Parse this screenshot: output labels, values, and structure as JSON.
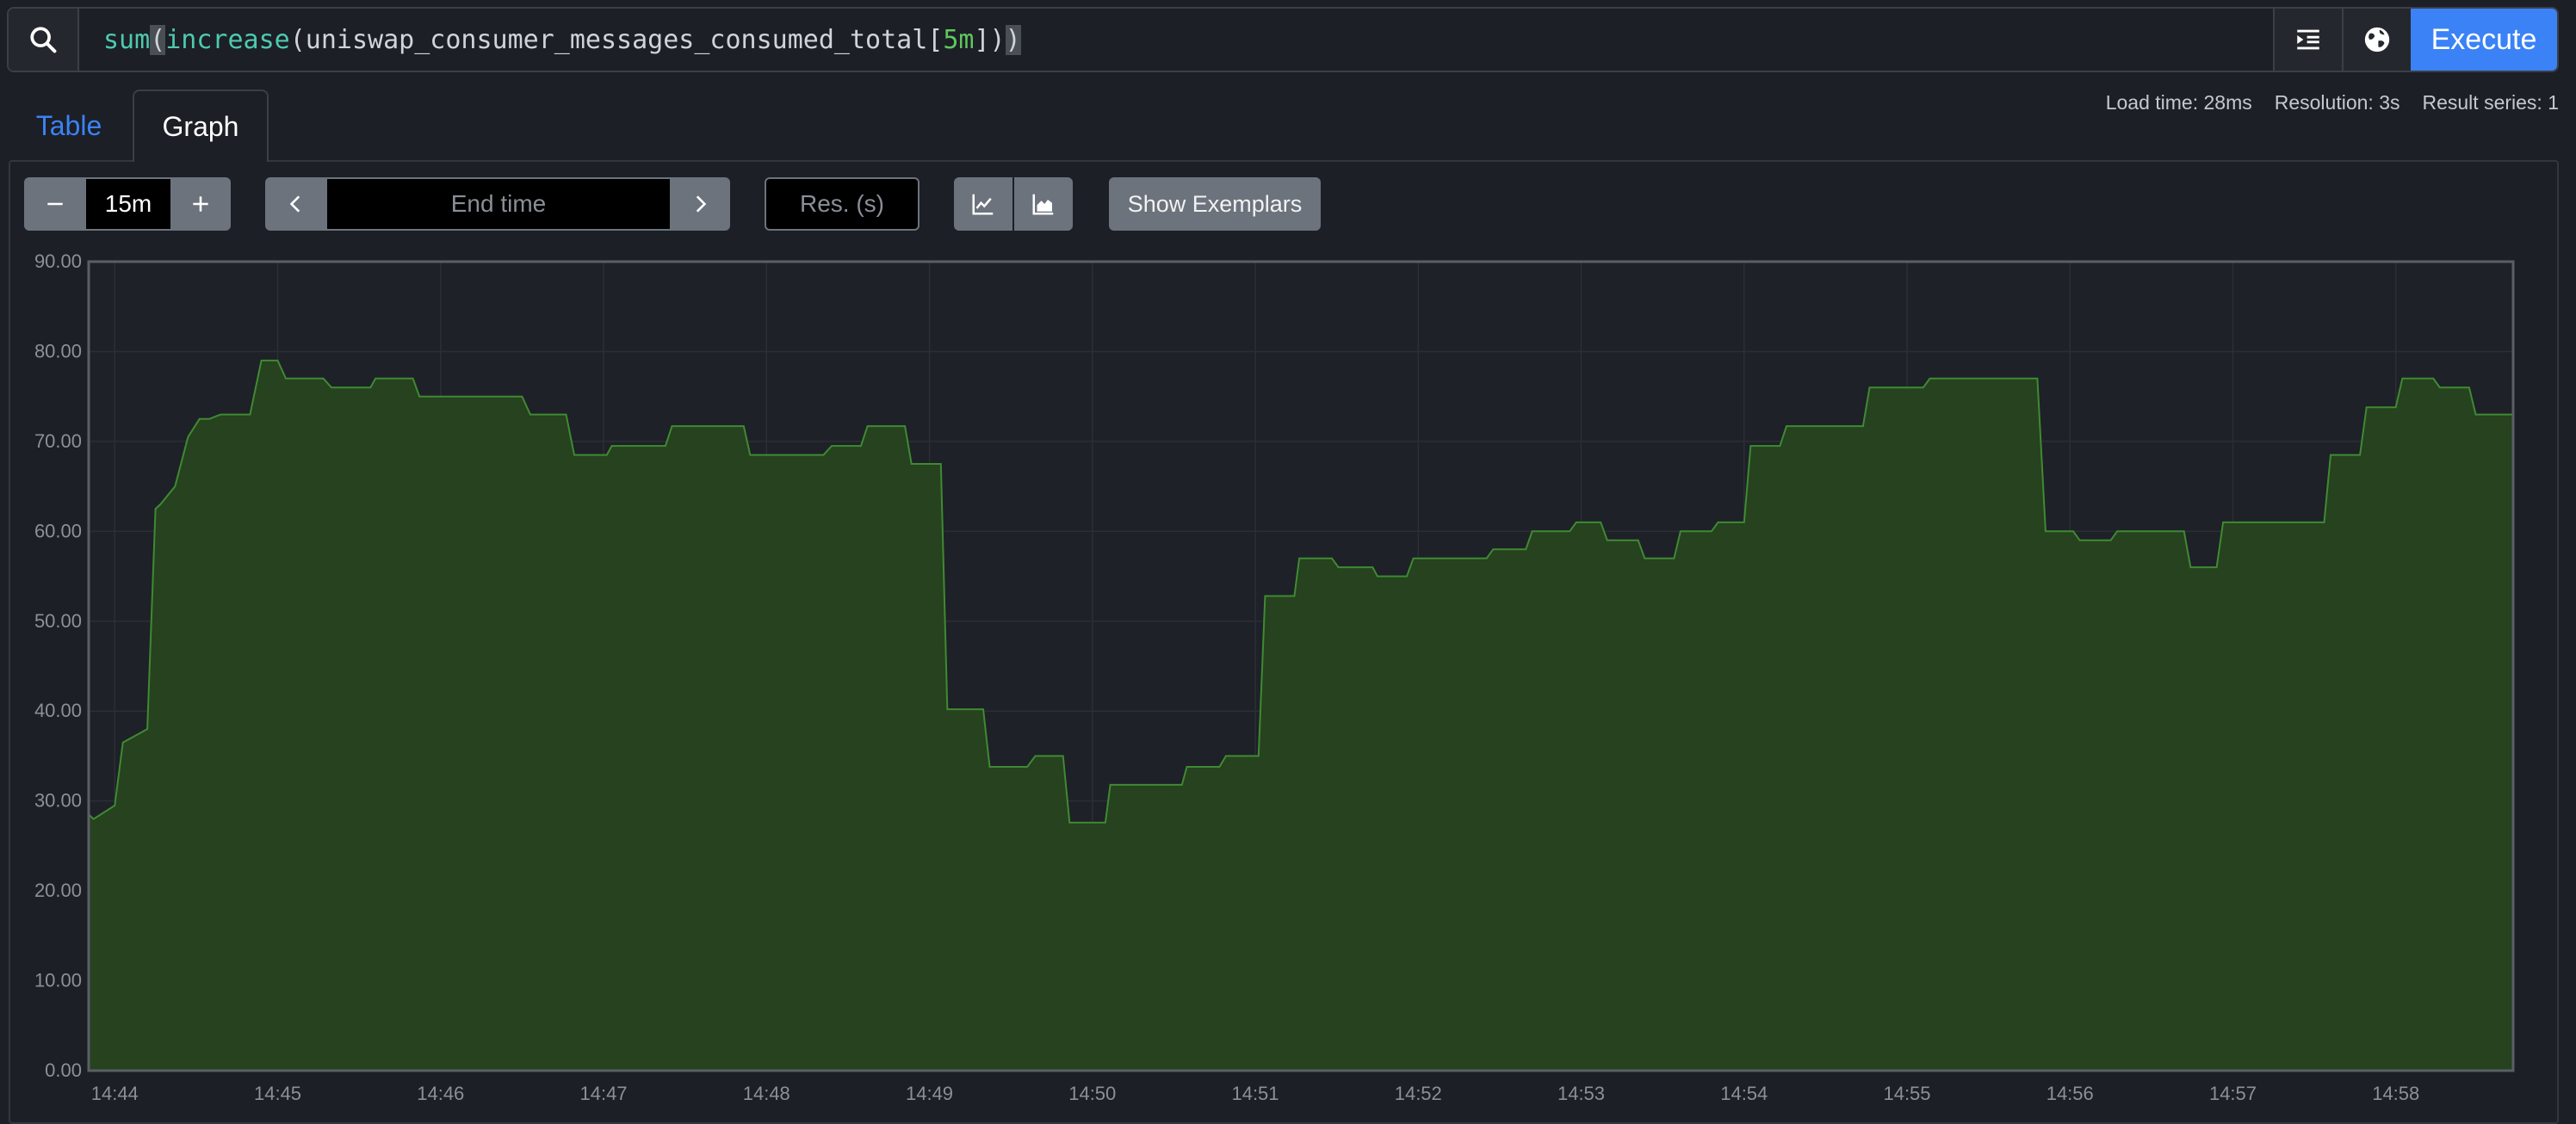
{
  "query_bar": {
    "query_parts": [
      {
        "text": "sum",
        "cls": "fn"
      },
      {
        "text": "(",
        "cls": "hl"
      },
      {
        "text": "increase",
        "cls": "fn"
      },
      {
        "text": "(uniswap_consumer_messages_consumed_total[",
        "cls": "paren"
      },
      {
        "text": "5m",
        "cls": "num"
      },
      {
        "text": "])",
        "cls": "paren"
      },
      {
        "text": ")",
        "cls": "hl"
      }
    ],
    "search_icon": "search-icon",
    "format_icon": "format-indent-icon",
    "metrics_icon": "globe-icon",
    "execute_label": "Execute",
    "execute_color": "#3b82f6"
  },
  "tabs": {
    "table_label": "Table",
    "graph_label": "Graph",
    "active": "Graph"
  },
  "stats": {
    "load_time": "Load time: 28ms",
    "resolution": "Resolution: 3s",
    "result_series": "Result series: 1"
  },
  "controls": {
    "range_minus_icon": "minus-icon",
    "range_value": "15m",
    "range_plus_icon": "plus-icon",
    "prev_icon": "chevron-left-icon",
    "end_time_placeholder": "End time",
    "next_icon": "chevron-right-icon",
    "resolution_placeholder": "Res. (s)",
    "line_icon": "line-chart-icon",
    "stacked_icon": "area-chart-icon",
    "exemplars_label": "Show Exemplars"
  },
  "chart_data": {
    "type": "area",
    "ylim": [
      0,
      90
    ],
    "y_ticks": [
      "0.00",
      "10.00",
      "20.00",
      "30.00",
      "40.00",
      "50.00",
      "60.00",
      "70.00",
      "80.00",
      "90.00"
    ],
    "x_ticks": [
      "14:44",
      "14:45",
      "14:46",
      "14:47",
      "14:48",
      "14:49",
      "14:50",
      "14:51",
      "14:52",
      "14:53",
      "14:54",
      "14:55",
      "14:56",
      "14:57",
      "14:58"
    ],
    "grid": true,
    "fill_color": "#26421f",
    "line_color": "#3f8a32",
    "series": [
      {
        "x_minutes": [
          43.84,
          43.87,
          44.0,
          44.05,
          44.2,
          44.25,
          44.28,
          44.37,
          44.45,
          44.52,
          44.58,
          44.65,
          44.72,
          44.83,
          44.9,
          45.0,
          45.05,
          45.28,
          45.33,
          45.57,
          45.6,
          45.83,
          45.87,
          46.08,
          46.12,
          46.5,
          46.55,
          46.77,
          46.82,
          47.02,
          47.05,
          47.38,
          47.42,
          47.86,
          47.9,
          48.35,
          48.4,
          48.58,
          48.62,
          48.85,
          48.89,
          49.07,
          49.11,
          49.33,
          49.37,
          49.6,
          49.65,
          49.82,
          49.86,
          50.08,
          50.11,
          50.55,
          50.58,
          50.78,
          50.82,
          51.02,
          51.06,
          51.24,
          51.27,
          51.47,
          51.51,
          51.72,
          51.75,
          51.93,
          51.97,
          52.42,
          52.46,
          52.66,
          52.7,
          52.93,
          52.97,
          53.12,
          53.16,
          53.35,
          53.39,
          53.57,
          53.61,
          53.8,
          53.84,
          54.0,
          54.04,
          54.22,
          54.26,
          54.42,
          54.46,
          54.73,
          54.77,
          55.1,
          55.14,
          55.33,
          55.37,
          55.8,
          55.85,
          56.02,
          56.06,
          56.25,
          56.29,
          56.7,
          56.74,
          56.9,
          56.94,
          57.34,
          57.38,
          57.56,
          57.6,
          57.78,
          57.82,
          58.0,
          58.04,
          58.23,
          58.27,
          58.45,
          58.49,
          58.72
        ],
        "values": [
          28.5,
          28,
          29.5,
          36.5,
          38,
          62.5,
          63,
          65,
          70.5,
          72.5,
          72.5,
          73,
          73,
          73,
          79,
          79,
          77,
          77,
          76,
          76,
          77,
          77,
          75,
          75,
          75,
          75,
          73,
          73,
          68.5,
          68.5,
          69.5,
          69.5,
          71.7,
          71.7,
          68.5,
          68.5,
          69.5,
          69.5,
          71.7,
          71.7,
          67.5,
          67.5,
          40.2,
          40.2,
          33.8,
          33.8,
          35,
          35,
          27.6,
          27.6,
          31.8,
          31.8,
          33.8,
          33.8,
          35,
          35,
          52.8,
          52.8,
          57,
          57,
          56,
          56,
          55,
          55,
          57,
          57,
          58,
          58,
          60,
          60,
          61,
          61,
          59,
          59,
          57,
          57,
          60,
          60,
          61,
          61,
          69.5,
          69.5,
          71.7,
          71.7,
          71.7,
          71.7,
          76,
          76,
          77,
          77,
          77,
          77,
          60,
          60,
          59,
          59,
          60,
          60,
          56,
          56,
          61,
          61,
          61,
          61,
          68.5,
          68.5,
          73.8,
          73.8,
          77,
          77,
          76,
          76,
          73,
          73
        ]
      }
    ]
  }
}
